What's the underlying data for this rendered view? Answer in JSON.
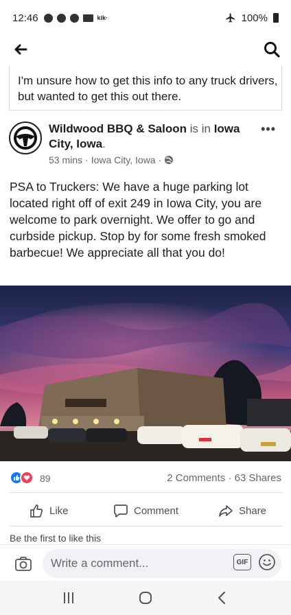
{
  "status_bar": {
    "time": "12:46",
    "kik_label": "kik·",
    "battery_text": "100%"
  },
  "intro_text": "I'm unsure how to get this info to any truck drivers, but wanted to get this out there.",
  "post": {
    "page_name": "Wildwood BBQ & Saloon",
    "is_in": "is in",
    "location_name": "Iowa City, Iowa",
    "time_ago": "53 mins",
    "location_meta": "Iowa City, Iowa",
    "body": "PSA to Truckers: We have a huge parking lot located right off of exit 249 in Iowa City, you are welcome to park overnight. We offer to go and curbside pickup. Stop by for some fresh smoked barbecue! We appreciate all that you do!"
  },
  "reactions": {
    "count": "89",
    "comments": "2 Comments",
    "shares": "63 Shares"
  },
  "actions": {
    "like": "Like",
    "comment": "Comment",
    "share": "Share"
  },
  "first_like_text": "Be the first to like this",
  "comment_box": {
    "placeholder": "Write a comment...",
    "gif_label": "GIF"
  },
  "colors": {
    "accent": "#1877f2",
    "love": "#f33e58",
    "text_muted": "#65676b"
  }
}
